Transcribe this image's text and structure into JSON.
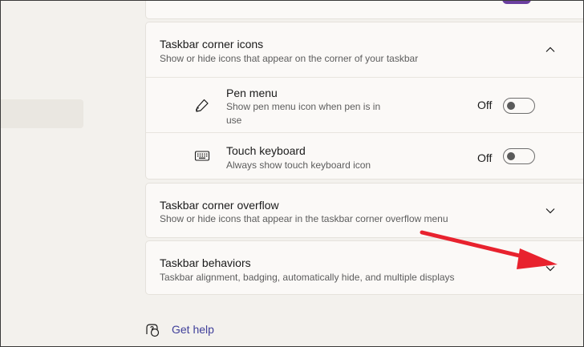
{
  "sections": {
    "corner_icons": {
      "title": "Taskbar corner icons",
      "description": "Show or hide icons that appear on the corner of your taskbar",
      "expanded": true,
      "items": [
        {
          "title": "Pen menu",
          "description": "Show pen menu icon when pen is in use",
          "state": "Off",
          "icon": "pen-icon"
        },
        {
          "title": "Touch keyboard",
          "description": "Always show touch keyboard icon",
          "state": "Off",
          "icon": "keyboard-icon"
        }
      ]
    },
    "corner_overflow": {
      "title": "Taskbar corner overflow",
      "description": "Show or hide icons that appear in the taskbar corner overflow menu",
      "expanded": false
    },
    "behaviors": {
      "title": "Taskbar behaviors",
      "description": "Taskbar alignment, badging, automatically hide, and multiple displays",
      "expanded": false
    }
  },
  "help": {
    "label": "Get help",
    "icon": "help-icon"
  },
  "annotation": {
    "type": "red-arrow",
    "color": "#e8222e"
  },
  "colors": {
    "accent": "#6b3fa0",
    "link": "#3f3f9a",
    "page_bg": "#f3f1ed",
    "card_bg": "#fbf9f7"
  }
}
